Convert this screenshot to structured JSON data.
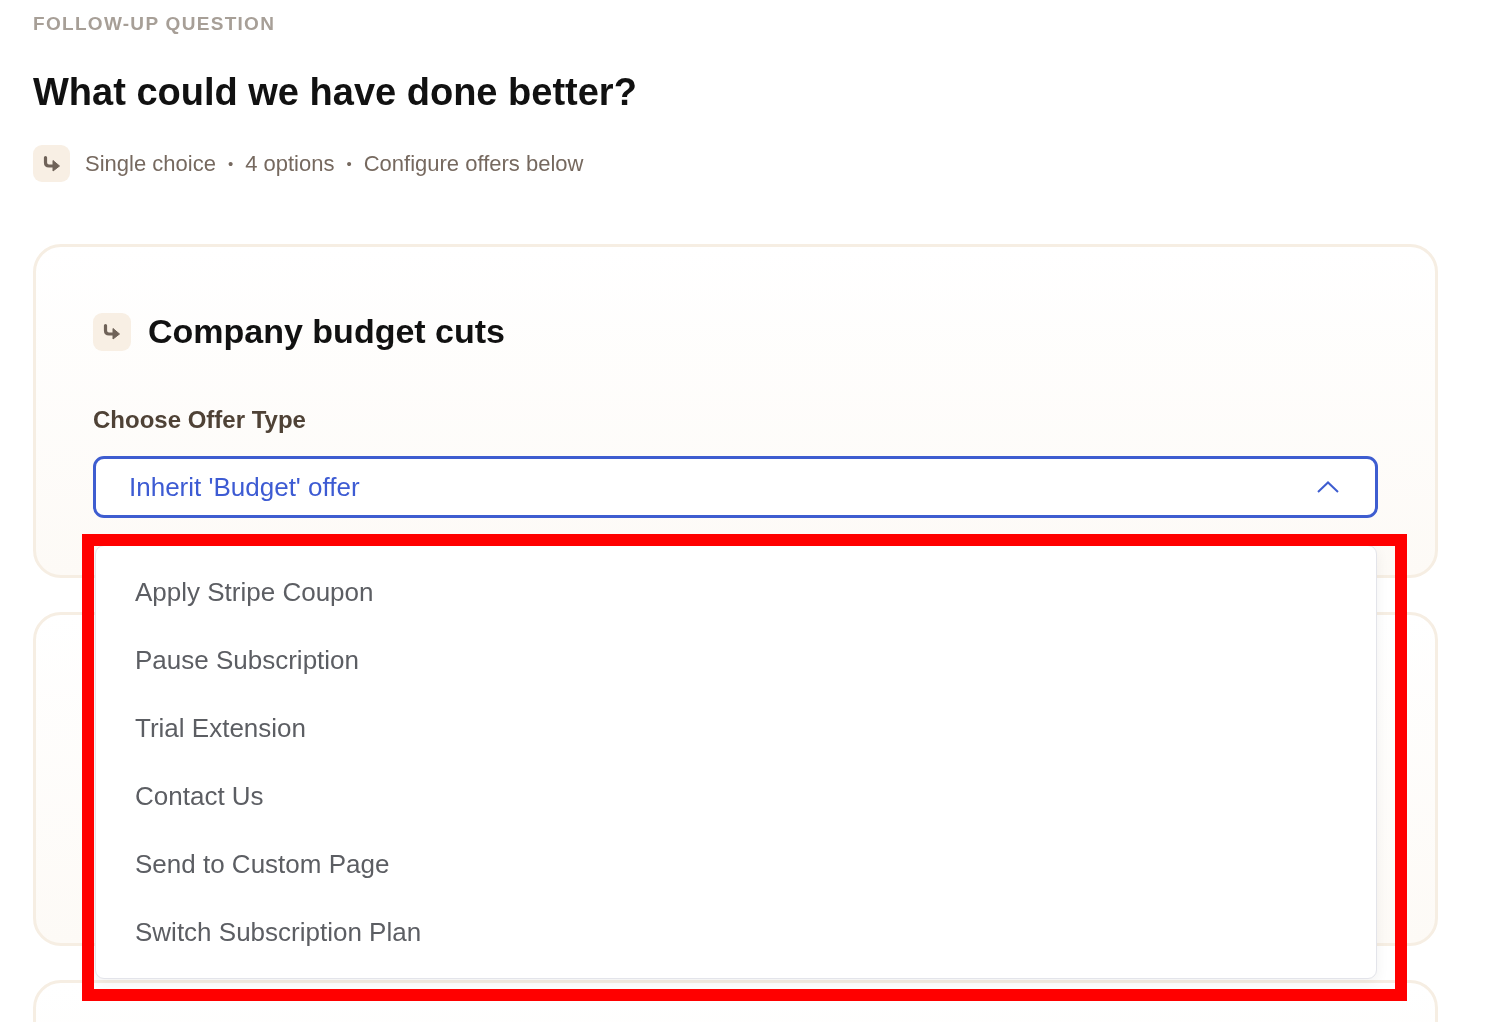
{
  "eyebrow": "FOLLOW-UP QUESTION",
  "question": "What could we have done better?",
  "meta": [
    {
      "kind": "item",
      "text": "Single choice"
    },
    {
      "kind": "separator",
      "text": "•"
    },
    {
      "kind": "item",
      "text": "4 options"
    },
    {
      "kind": "separator",
      "text": "•"
    },
    {
      "kind": "item",
      "text": "Configure offers below"
    }
  ],
  "cards": [
    {
      "obscured": false,
      "title": "Company budget cuts",
      "offer_type": {
        "label": "Choose Offer Type",
        "value": "Inherit 'Budget' offer",
        "expanded": true,
        "highlighted": true,
        "options": [
          {
            "label": "Apply Stripe Coupon",
            "selected": false
          },
          {
            "label": "Pause Subscription",
            "selected": false
          },
          {
            "label": "Trial Extension",
            "selected": false
          },
          {
            "label": "Contact Us",
            "selected": false
          },
          {
            "label": "Send to Custom Page",
            "selected": false
          },
          {
            "label": "Switch Subscription Plan",
            "selected": false
          }
        ]
      }
    },
    {
      "obscured": true
    },
    {
      "obscured": true
    }
  ]
}
